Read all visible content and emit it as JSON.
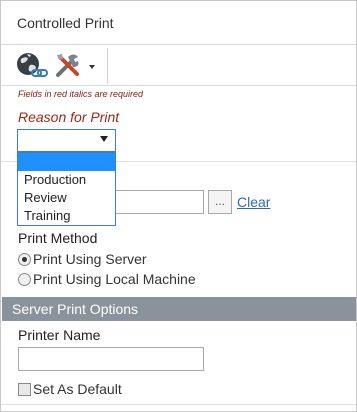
{
  "window": {
    "title": "Controlled Print"
  },
  "toolbar": {
    "globe_icon": "globe-link-icon",
    "tools_icon": "tools-icon"
  },
  "form": {
    "required_note": "Fields in red italics are required",
    "reason_label": "Reason for Print",
    "reason_selected": "",
    "reason_options": [
      "",
      "Production",
      "Review",
      "Training"
    ],
    "file_value": "",
    "browse_label": "...",
    "clear_label": "Clear",
    "print_method_label": "Print Method",
    "print_methods": [
      {
        "label": "Print Using Server",
        "checked": true
      },
      {
        "label": "Print Using Local Machine",
        "checked": false
      }
    ],
    "server_section_title": "Server Print Options",
    "printer_name_label": "Printer Name",
    "printer_name_value": "",
    "set_default_label": "Set As Default",
    "set_default_checked": false
  },
  "colors": {
    "required_red": "#9b2a16",
    "section_header_bg": "#8a939b",
    "link_blue": "#2a6db0",
    "selection_blue": "#1e90ff"
  }
}
